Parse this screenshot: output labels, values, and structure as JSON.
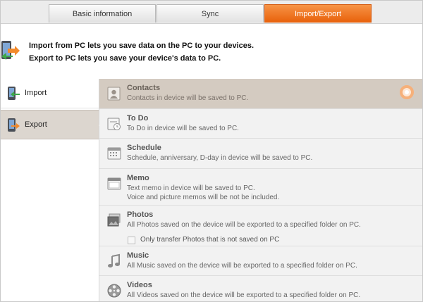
{
  "tabs": [
    {
      "label": "Basic information"
    },
    {
      "label": "Sync"
    },
    {
      "label": "Import/Export"
    }
  ],
  "header": {
    "line1": "Import from PC lets you save data on the PC to your devices.",
    "line2": "Export to PC lets you save your device's data to PC."
  },
  "sidebar": {
    "items": [
      {
        "label": "Import"
      },
      {
        "label": "Export"
      }
    ]
  },
  "list": [
    {
      "title": "Contacts",
      "desc": "Contacts in device will be saved  to PC."
    },
    {
      "title": "To Do",
      "desc": "To Do in device will be saved  to PC."
    },
    {
      "title": "Schedule",
      "desc": "Schedule, anniversary, D-day in device will be saved  to PC."
    },
    {
      "title": "Memo",
      "desc": "Text memo in device will be saved  to PC.",
      "desc2": "Voice and picture memos will be not be included."
    },
    {
      "title": "Photos",
      "desc": "All Photos saved on the device will be exported to a specified folder on PC.",
      "checkbox": "Only transfer Photos that is not saved on PC"
    },
    {
      "title": "Music",
      "desc": "All Music saved on the device will be exported to a specified folder on PC."
    },
    {
      "title": "Videos",
      "desc": "All Videos saved on the device will be exported to a specified folder on PC."
    }
  ],
  "colors": {
    "accent": "#f07a28",
    "selected_row": "#d4cbc1",
    "selected_side": "#dcd6cf"
  }
}
